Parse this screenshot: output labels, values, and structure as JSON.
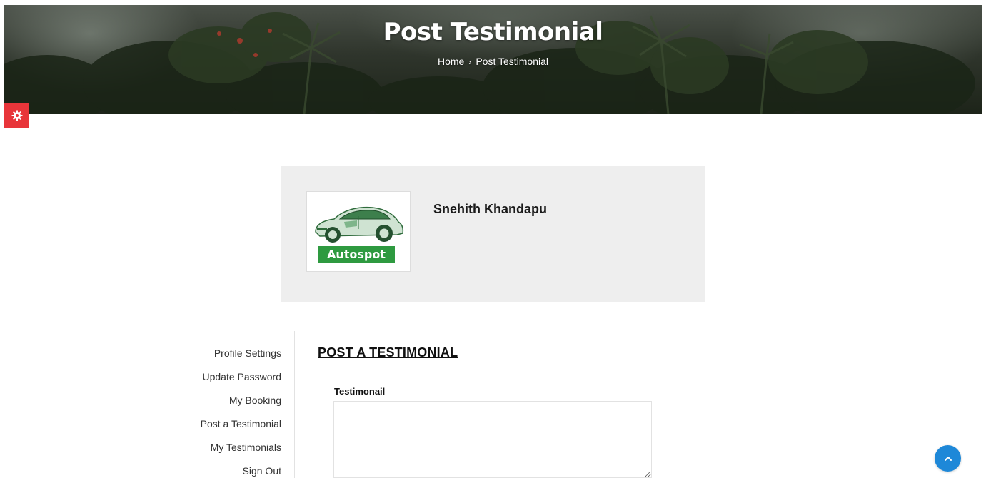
{
  "hero": {
    "title": "Post Testimonial",
    "breadcrumb": {
      "home": "Home",
      "separator": "›",
      "current": "Post Testimonial"
    }
  },
  "settings_button": {
    "icon": "gear-icon",
    "color": "#e8353a"
  },
  "profile": {
    "name": "Snehith Khandapu",
    "avatar_brand": "Autospot",
    "brand_color": "#2e9a40"
  },
  "sidebar": {
    "items": [
      {
        "label": "Profile Settings"
      },
      {
        "label": "Update Password"
      },
      {
        "label": "My Booking"
      },
      {
        "label": "Post a Testimonial"
      },
      {
        "label": "My Testimonials"
      },
      {
        "label": "Sign Out"
      }
    ]
  },
  "form": {
    "title": "POST A TESTIMONIAL",
    "testimonial_label": "Testimonail",
    "testimonial_value": "",
    "testimonial_placeholder": ""
  },
  "scroll_top": {
    "icon": "chevron-up-icon",
    "color": "#1e88d8"
  }
}
